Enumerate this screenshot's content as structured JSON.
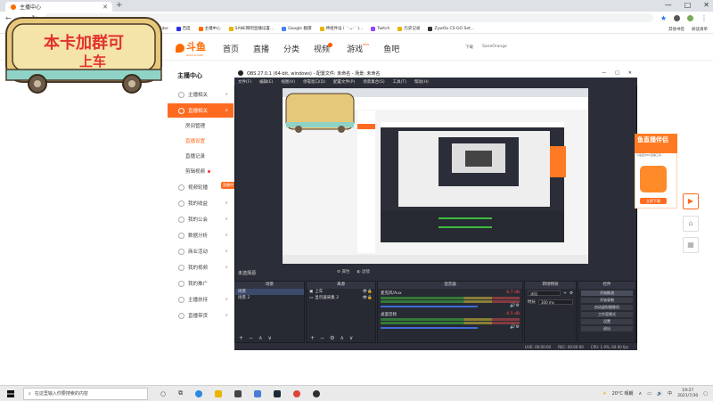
{
  "browser": {
    "tab_title": "主播中心",
    "window_controls": [
      "—",
      "□",
      "✕"
    ],
    "bookmarks": [
      "应用",
      "Debian",
      "reddit",
      "Gmail",
      "YouTube",
      "百度",
      "主播中心",
      "SANE网吧直播设置...",
      "Google 翻譯",
      "神组件设 ( ´･ᴗ･` )...",
      "Twitch",
      "历史记录",
      "ZywOo CS:GO Set..."
    ],
    "bookmarks_right": [
      "其他书签",
      "阅读清单"
    ]
  },
  "site": {
    "logo_text": "斗鱼",
    "logo_sub": "DOUYU.COM",
    "nav": [
      "首页",
      "直播",
      "分类",
      "视频",
      "游戏",
      "鱼吧"
    ],
    "nav_new_badge": "NEW",
    "header_right": [
      "下载",
      "SaneOrange"
    ]
  },
  "sticker": {
    "line1": "本卡加群可",
    "line2": "上车"
  },
  "sidebar": {
    "title": "主播中心",
    "items": [
      {
        "label": "主播相关",
        "arrow": "∧"
      },
      {
        "label": "直播相关",
        "arrow": "∧"
      },
      {
        "label": "房间管理"
      },
      {
        "label": "直播设置"
      },
      {
        "label": "直播记录"
      },
      {
        "label": "剪辑视频"
      },
      {
        "label": "视频轮播",
        "arrow": "∨"
      },
      {
        "label": "我的收益",
        "arrow": "∨"
      },
      {
        "label": "我的公会",
        "arrow": "∨"
      },
      {
        "label": "数据分析",
        "arrow": "∨"
      },
      {
        "label": "商业活动",
        "arrow": "∨"
      },
      {
        "label": "我的视频",
        "arrow": "∨"
      },
      {
        "label": "我的推广"
      },
      {
        "label": "主播扶持",
        "arrow": "∨"
      },
      {
        "label": "直播带货",
        "arrow": "∨"
      }
    ],
    "live_tag": "直播中"
  },
  "obs": {
    "title": "OBS 27.0.1 (64-bit, windows) - 配置文件: 未命名 - 场景: 未命名",
    "menu": [
      "文件(F)",
      "编辑(E)",
      "视图(V)",
      "停靠窗口(D)",
      "配置文件(P)",
      "场景集合(S)",
      "工具(T)",
      "帮助(H)"
    ],
    "no_source": "未选择源",
    "source_tabs": [
      "属性",
      "滤镜"
    ],
    "docks": {
      "scenes": {
        "header": "场景",
        "rows": [
          "场景",
          "场景 2"
        ]
      },
      "sources": {
        "header": "来源",
        "rows": [
          "上车",
          "显示器采集 2"
        ]
      },
      "mixer": {
        "header": "混音器",
        "channels": [
          {
            "name": "麦克风/Aux",
            "db": "-0.7 dB"
          },
          {
            "name": "桌面音频",
            "db": "-0.5 dB"
          }
        ]
      },
      "transitions": {
        "header": "转场特效",
        "type": "淡出",
        "duration_label": "时长",
        "duration": "300 ms"
      },
      "controls": {
        "header": "控件",
        "buttons": [
          "开始推流",
          "开始录制",
          "启动虚拟摄像机",
          "工作室模式",
          "设置",
          "退出"
        ]
      }
    },
    "status": [
      "LIVE: 00:00:00",
      "REC: 00:00:00",
      "CPU: 1.9%, 60.00 fps"
    ]
  },
  "promo": {
    "title": "鱼直播伴侣",
    "subtitle": "斗鱼官方PC直播工具",
    "button": "立即下载"
  },
  "taskbar": {
    "search_placeholder": "在这里输入你要搜索的内容",
    "weather": "20°C 晴朗",
    "ime": "中",
    "time": "19:27",
    "date": "2021/7/30"
  }
}
